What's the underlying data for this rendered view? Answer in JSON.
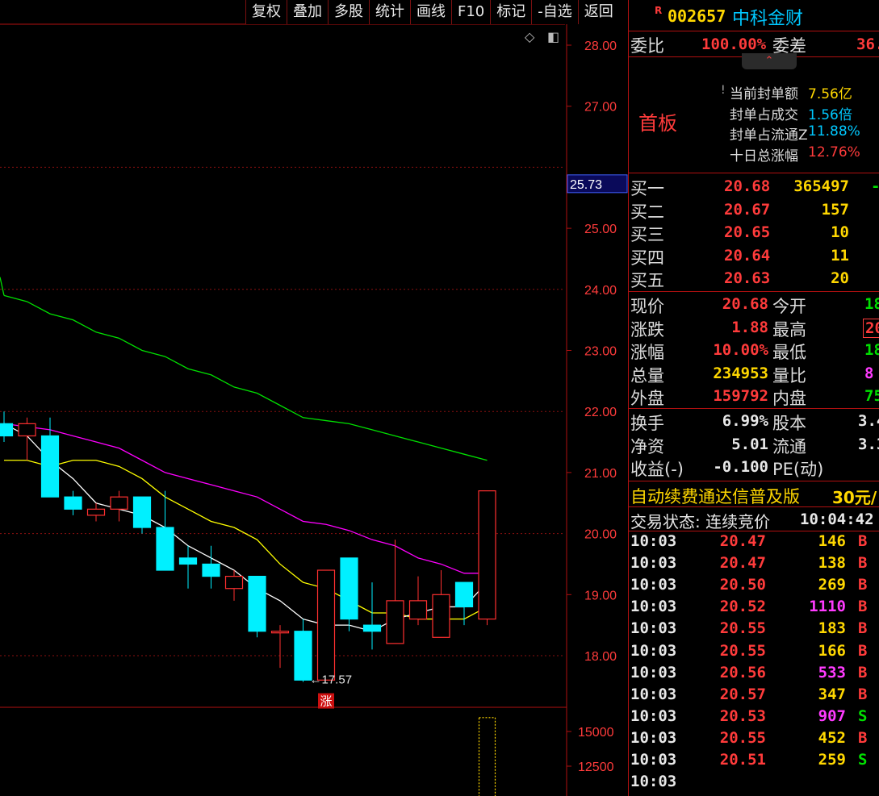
{
  "toolbar": {
    "items": [
      "复权",
      "叠加",
      "多股",
      "统计",
      "画线",
      "F10",
      "标记",
      "-自选",
      "返回"
    ]
  },
  "chart": {
    "price_ticks": [
      "28.00",
      "27.00",
      "25.73",
      "25.00",
      "24.00",
      "23.00",
      "22.00",
      "21.00",
      "20.00",
      "19.00",
      "18.00"
    ],
    "current_price_badge": "25.73",
    "low_marker_label": "←17.57",
    "limit_up_marker": "涨",
    "volume_ticks": [
      "15000",
      "12500"
    ],
    "colors": {
      "up": "#ff3030",
      "down": "#00f0ff",
      "ma5": "#ffffff",
      "ma10": "#ffff00",
      "ma20": "#ff00ff",
      "ma60": "#00e000"
    }
  },
  "chart_data": {
    "type": "candlestick",
    "ylim": [
      17.2,
      28.3
    ],
    "candles": [
      {
        "o": 21.8,
        "c": 21.6,
        "h": 22.0,
        "l": 21.5
      },
      {
        "o": 21.6,
        "c": 21.8,
        "h": 21.9,
        "l": 21.2
      },
      {
        "o": 21.6,
        "c": 20.6,
        "h": 21.9,
        "l": 20.6
      },
      {
        "o": 20.6,
        "c": 20.4,
        "h": 20.7,
        "l": 20.3
      },
      {
        "o": 20.3,
        "c": 20.4,
        "h": 20.5,
        "l": 20.2
      },
      {
        "o": 20.4,
        "c": 20.6,
        "h": 20.7,
        "l": 20.2
      },
      {
        "o": 20.6,
        "c": 20.1,
        "h": 20.6,
        "l": 20.0
      },
      {
        "o": 20.1,
        "c": 19.4,
        "h": 20.7,
        "l": 19.4
      },
      {
        "o": 19.6,
        "c": 19.5,
        "h": 19.8,
        "l": 19.1
      },
      {
        "o": 19.5,
        "c": 19.3,
        "h": 19.8,
        "l": 19.1
      },
      {
        "o": 19.1,
        "c": 19.3,
        "h": 19.4,
        "l": 18.9
      },
      {
        "o": 19.3,
        "c": 18.4,
        "h": 19.3,
        "l": 18.3
      },
      {
        "o": 18.4,
        "c": 18.4,
        "h": 18.5,
        "l": 17.8
      },
      {
        "o": 18.4,
        "c": 17.6,
        "h": 18.6,
        "l": 17.57
      },
      {
        "o": 17.6,
        "c": 19.4,
        "h": 19.4,
        "l": 17.6
      },
      {
        "o": 19.6,
        "c": 18.6,
        "h": 19.6,
        "l": 18.4
      },
      {
        "o": 18.5,
        "c": 18.4,
        "h": 19.2,
        "l": 18.1
      },
      {
        "o": 18.2,
        "c": 18.9,
        "h": 19.9,
        "l": 18.2
      },
      {
        "o": 18.6,
        "c": 18.9,
        "h": 19.3,
        "l": 18.5
      },
      {
        "o": 18.3,
        "c": 19.0,
        "h": 19.4,
        "l": 18.3
      },
      {
        "o": 19.2,
        "c": 18.8,
        "h": 19.2,
        "l": 18.5
      },
      {
        "o": 18.6,
        "c": 20.7,
        "h": 20.7,
        "l": 18.5
      }
    ],
    "ma5": [
      21.8,
      21.6,
      21.2,
      20.9,
      20.5,
      20.4,
      20.3,
      20.1,
      19.8,
      19.6,
      19.4,
      19.1,
      18.9,
      18.6,
      18.5,
      18.5,
      18.4,
      18.6,
      18.7,
      18.8,
      18.8,
      19.2
    ],
    "ma10": [
      21.2,
      21.2,
      21.1,
      21.2,
      21.2,
      21.1,
      20.9,
      20.6,
      20.4,
      20.2,
      20.1,
      19.9,
      19.5,
      19.2,
      19.1,
      18.9,
      18.7,
      18.7,
      18.6,
      18.6,
      18.6,
      18.8
    ],
    "ma20": [
      21.8,
      21.75,
      21.7,
      21.6,
      21.5,
      21.4,
      21.2,
      21.0,
      20.9,
      20.8,
      20.7,
      20.6,
      20.4,
      20.2,
      20.15,
      20.05,
      19.9,
      19.8,
      19.6,
      19.5,
      19.35,
      19.35
    ],
    "ma60": [
      23.9,
      23.8,
      23.6,
      23.5,
      23.3,
      23.2,
      23.0,
      22.9,
      22.7,
      22.6,
      22.4,
      22.3,
      22.1,
      21.9,
      21.85,
      21.8,
      21.7,
      21.6,
      21.5,
      21.4,
      21.3,
      21.2
    ],
    "volume_last_bar": 16000
  },
  "panel": {
    "header": {
      "badge": "R",
      "code": "002657",
      "name": "中科金财"
    },
    "weibi": {
      "label": "委比",
      "value": "100.00%",
      "diff_label": "委差",
      "diff_value": "36."
    },
    "board": {
      "tag": "首板",
      "rows": [
        {
          "label": "当前封单额",
          "value": "7.56亿"
        },
        {
          "label": "封单占成交",
          "value": "1.56倍"
        },
        {
          "label": "封单占流通Z",
          "value": "11.88%"
        },
        {
          "label": "十日总涨幅",
          "value": "12.76%"
        }
      ]
    },
    "buy": [
      {
        "label": "买一",
        "price": "20.68",
        "vol": "365497",
        "extra": "-"
      },
      {
        "label": "买二",
        "price": "20.67",
        "vol": "157"
      },
      {
        "label": "买三",
        "price": "20.65",
        "vol": "10"
      },
      {
        "label": "买四",
        "price": "20.64",
        "vol": "11"
      },
      {
        "label": "买五",
        "price": "20.63",
        "vol": "20"
      }
    ],
    "quote": [
      {
        "l1": "现价",
        "v1": "20.68",
        "l2": "今开",
        "v2": "18"
      },
      {
        "l1": "涨跌",
        "v1": "1.88",
        "l2": "最高",
        "v2": "20"
      },
      {
        "l1": "涨幅",
        "v1": "10.00%",
        "l2": "最低",
        "v2": "18"
      },
      {
        "l1": "总量",
        "v1": "234953",
        "l2": "量比",
        "v2": "8"
      },
      {
        "l1": "外盘",
        "v1": "159792",
        "l2": "内盘",
        "v2": "75"
      }
    ],
    "fin": [
      {
        "l1": "换手",
        "v1": "6.99%",
        "l2": "股本",
        "v2": "3.4"
      },
      {
        "l1": "净资",
        "v1": "5.01",
        "l2": "流通",
        "v2": "3.3"
      },
      {
        "l1": "收益(-)",
        "v1": "-0.100",
        "l2": "PE(动)",
        "v2": ""
      }
    ],
    "promo": {
      "text": "自动续费通达信普及版",
      "price": "30元/"
    },
    "status": {
      "label": "交易状态: 连续竞价",
      "time": "10:04:42"
    },
    "ticks": [
      {
        "t": "10:03",
        "p": "20.47",
        "v": "146",
        "s": "B",
        "vc": "yel"
      },
      {
        "t": "10:03",
        "p": "20.47",
        "v": "138",
        "s": "B",
        "vc": "yel"
      },
      {
        "t": "10:03",
        "p": "20.50",
        "v": "269",
        "s": "B",
        "vc": "yel"
      },
      {
        "t": "10:03",
        "p": "20.52",
        "v": "1110",
        "s": "B",
        "vc": "mag"
      },
      {
        "t": "10:03",
        "p": "20.55",
        "v": "183",
        "s": "B",
        "vc": "yel"
      },
      {
        "t": "10:03",
        "p": "20.55",
        "v": "166",
        "s": "B",
        "vc": "yel"
      },
      {
        "t": "10:03",
        "p": "20.56",
        "v": "533",
        "s": "B",
        "vc": "mag"
      },
      {
        "t": "10:03",
        "p": "20.57",
        "v": "347",
        "s": "B",
        "vc": "yel"
      },
      {
        "t": "10:03",
        "p": "20.53",
        "v": "907",
        "s": "S",
        "vc": "mag"
      },
      {
        "t": "10:03",
        "p": "20.55",
        "v": "452",
        "s": "B",
        "vc": "yel"
      },
      {
        "t": "10:03",
        "p": "20.51",
        "v": "259",
        "s": "S",
        "vc": "yel"
      },
      {
        "t": "10:03",
        "p": "",
        "v": "",
        "s": "",
        "vc": "yel"
      }
    ]
  }
}
